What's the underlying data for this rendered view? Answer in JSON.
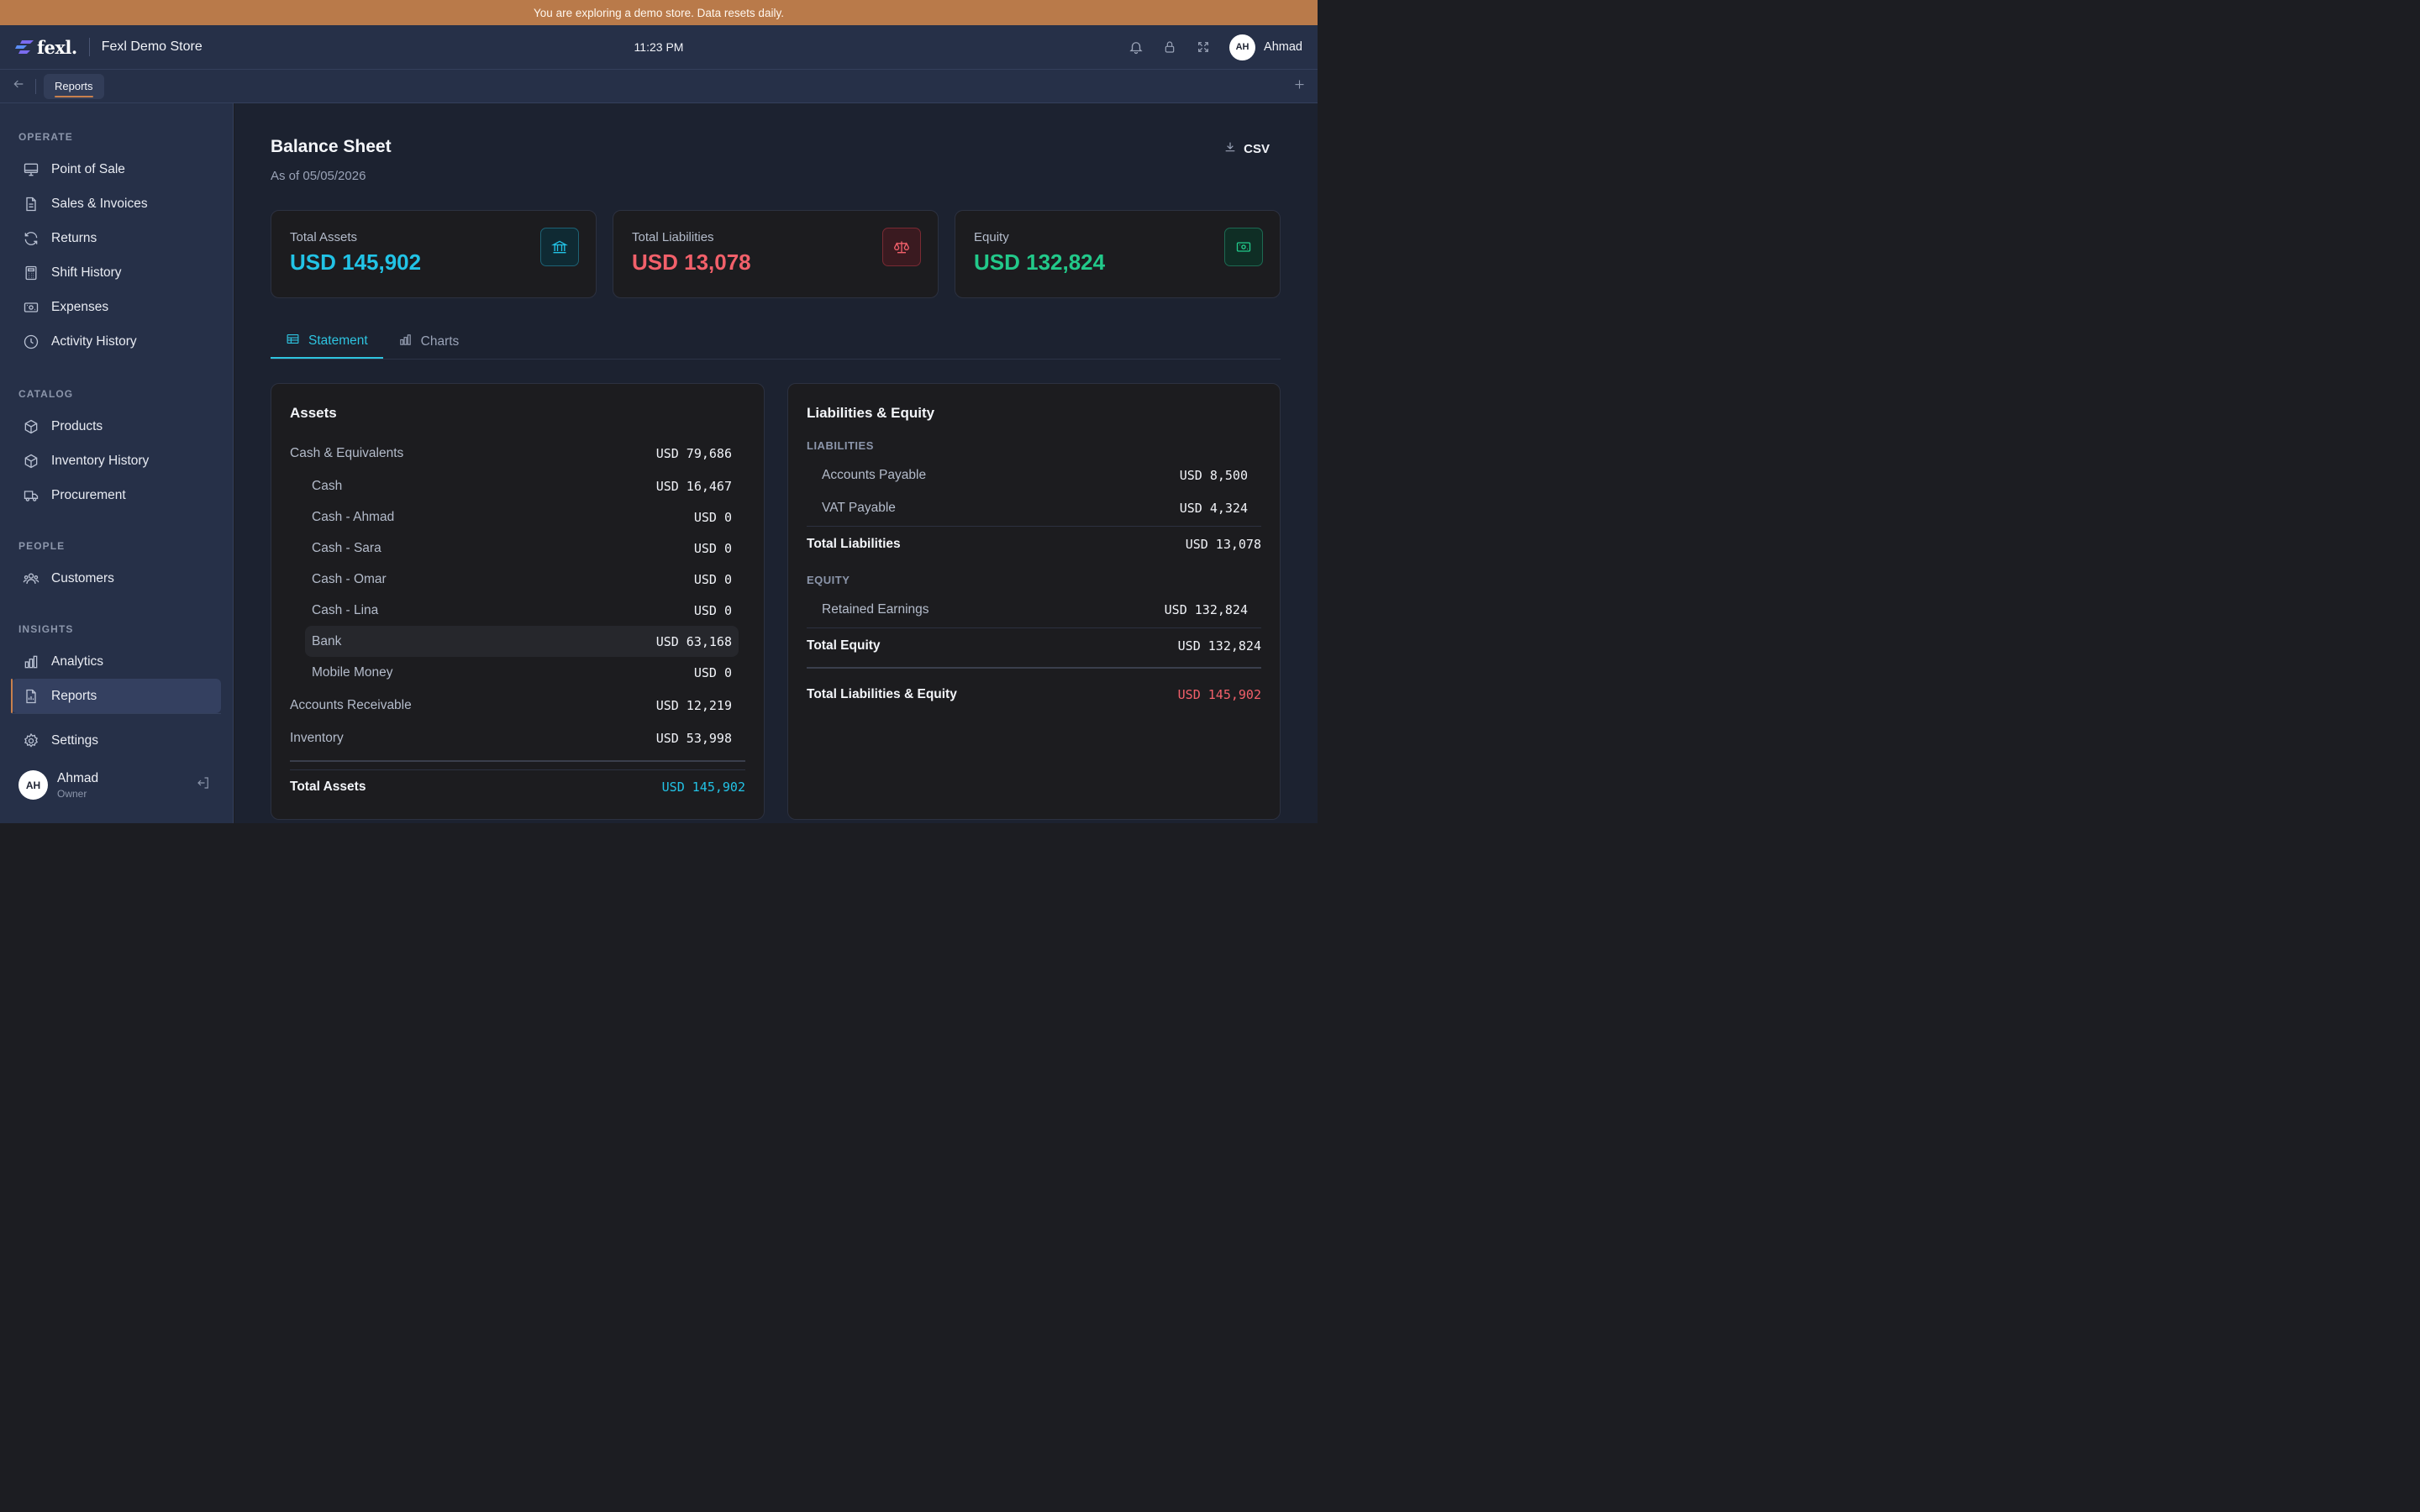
{
  "banner": "You are exploring a demo store. Data resets daily.",
  "header": {
    "logo_text": "fexl.",
    "store_name": "Fexl Demo Store",
    "time": "11:23 PM",
    "user_initials": "AH",
    "user_name": "Ahmad"
  },
  "tabbar": {
    "active_tab": "Reports"
  },
  "sidebar": {
    "sections": {
      "operate": "OPERATE",
      "catalog": "CATALOG",
      "people": "PEOPLE",
      "insights": "INSIGHTS"
    },
    "items": {
      "pos": "Point of Sale",
      "sales": "Sales & Invoices",
      "returns": "Returns",
      "shift": "Shift History",
      "expenses": "Expenses",
      "activity": "Activity History",
      "products": "Products",
      "inventory": "Inventory History",
      "procurement": "Procurement",
      "customers": "Customers",
      "analytics": "Analytics",
      "reports": "Reports",
      "settings": "Settings"
    },
    "user": {
      "initials": "AH",
      "name": "Ahmad",
      "role": "Owner"
    }
  },
  "page": {
    "title": "Balance Sheet",
    "subtitle": "As of 05/05/2026",
    "csv_label": "CSV"
  },
  "cards": {
    "assets": {
      "label": "Total Assets",
      "value": "USD 145,902",
      "color": "#22c3e6"
    },
    "liabilities": {
      "label": "Total Liabilities",
      "value": "USD 13,078",
      "color": "#f2606a"
    },
    "equity": {
      "label": "Equity",
      "value": "USD 132,824",
      "color": "#22c98a"
    }
  },
  "tabs": {
    "statement": "Statement",
    "charts": "Charts"
  },
  "assets": {
    "title": "Assets",
    "cash_equiv": {
      "label": "Cash & Equivalents",
      "value": "USD 79,686"
    },
    "cash": {
      "label": "Cash",
      "value": "USD 16,467"
    },
    "cash_ahmad": {
      "label": "Cash - Ahmad",
      "value": "USD 0"
    },
    "cash_sara": {
      "label": "Cash - Sara",
      "value": "USD 0"
    },
    "cash_omar": {
      "label": "Cash - Omar",
      "value": "USD 0"
    },
    "cash_lina": {
      "label": "Cash - Lina",
      "value": "USD 0"
    },
    "bank": {
      "label": "Bank",
      "value": "USD 63,168"
    },
    "mobile": {
      "label": "Mobile Money",
      "value": "USD 0"
    },
    "receivable": {
      "label": "Accounts Receivable",
      "value": "USD 12,219"
    },
    "inventory": {
      "label": "Inventory",
      "value": "USD 53,998"
    },
    "total": {
      "label": "Total Assets",
      "value": "USD 145,902"
    }
  },
  "liab_equity": {
    "title": "Liabilities & Equity",
    "liab_cap": "LIABILITIES",
    "payable": {
      "label": "Accounts Payable",
      "value": "USD 8,500"
    },
    "vat": {
      "label": "VAT Payable",
      "value": "USD 4,324"
    },
    "total_liab": {
      "label": "Total Liabilities",
      "value": "USD 13,078"
    },
    "equity_cap": "EQUITY",
    "retained": {
      "label": "Retained Earnings",
      "value": "USD 132,824"
    },
    "total_equity": {
      "label": "Total Equity",
      "value": "USD 132,824"
    },
    "total_le": {
      "label": "Total Liabilities & Equity",
      "value": "USD 145,902"
    }
  }
}
